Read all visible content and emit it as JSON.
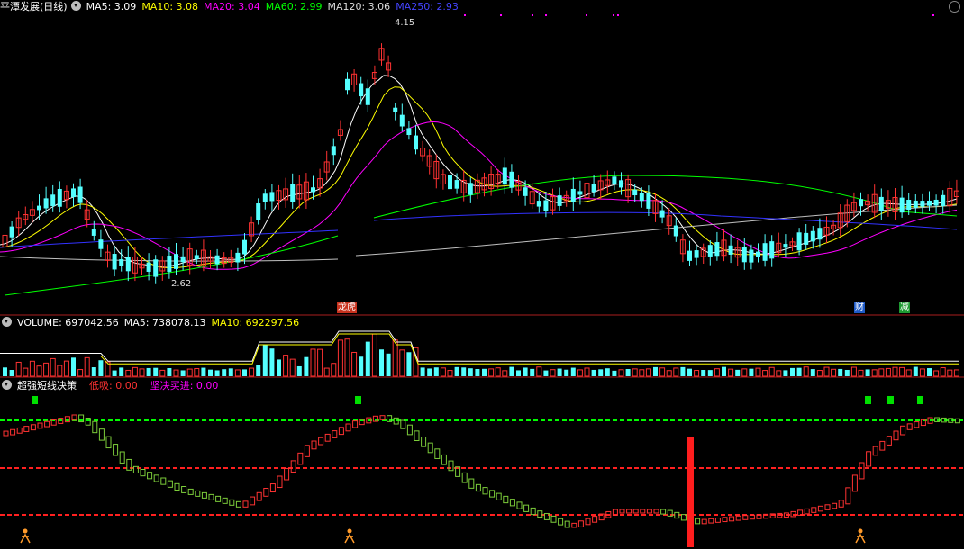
{
  "main_header": {
    "title": "平潭发展(日线)",
    "ma5": "MA5: 3.09",
    "ma10": "MA10: 3.08",
    "ma20": "MA20: 3.04",
    "ma60": "MA60: 2.99",
    "ma120": "MA120: 3.06",
    "ma250": "MA250: 2.93"
  },
  "price_labels": {
    "high": "4.15",
    "low": "2.62"
  },
  "event_tags": {
    "tag1": "龙虎",
    "tag2": "财",
    "tag3": "减"
  },
  "volume_header": {
    "volume": "VOLUME: 697042.56",
    "ma5": "MA5: 738078.13",
    "ma10": "MA10: 692297.56"
  },
  "indicator_header": {
    "name": "超强短线决策",
    "low_buy": "低吸: 0.00",
    "firm_buy": "坚决买进: 0.00"
  },
  "colors": {
    "up": "#ff3232",
    "down": "#54ffff",
    "ma5": "#ffffff",
    "ma10": "#ffff00",
    "ma20": "#ff00ff",
    "ma60": "#00ff00",
    "ma120": "#c0c0c0",
    "ma250": "#3232ff"
  },
  "chart_data": {
    "type": "candlestick",
    "price_high": 4.15,
    "price_low": 2.62,
    "ma_values": {
      "MA5": 3.09,
      "MA10": 3.08,
      "MA20": 3.04,
      "MA60": 2.99,
      "MA120": 3.06,
      "MA250": 2.93
    },
    "volume": 697042.56,
    "volume_ma5": 738078.13,
    "volume_ma10": 692297.56
  }
}
